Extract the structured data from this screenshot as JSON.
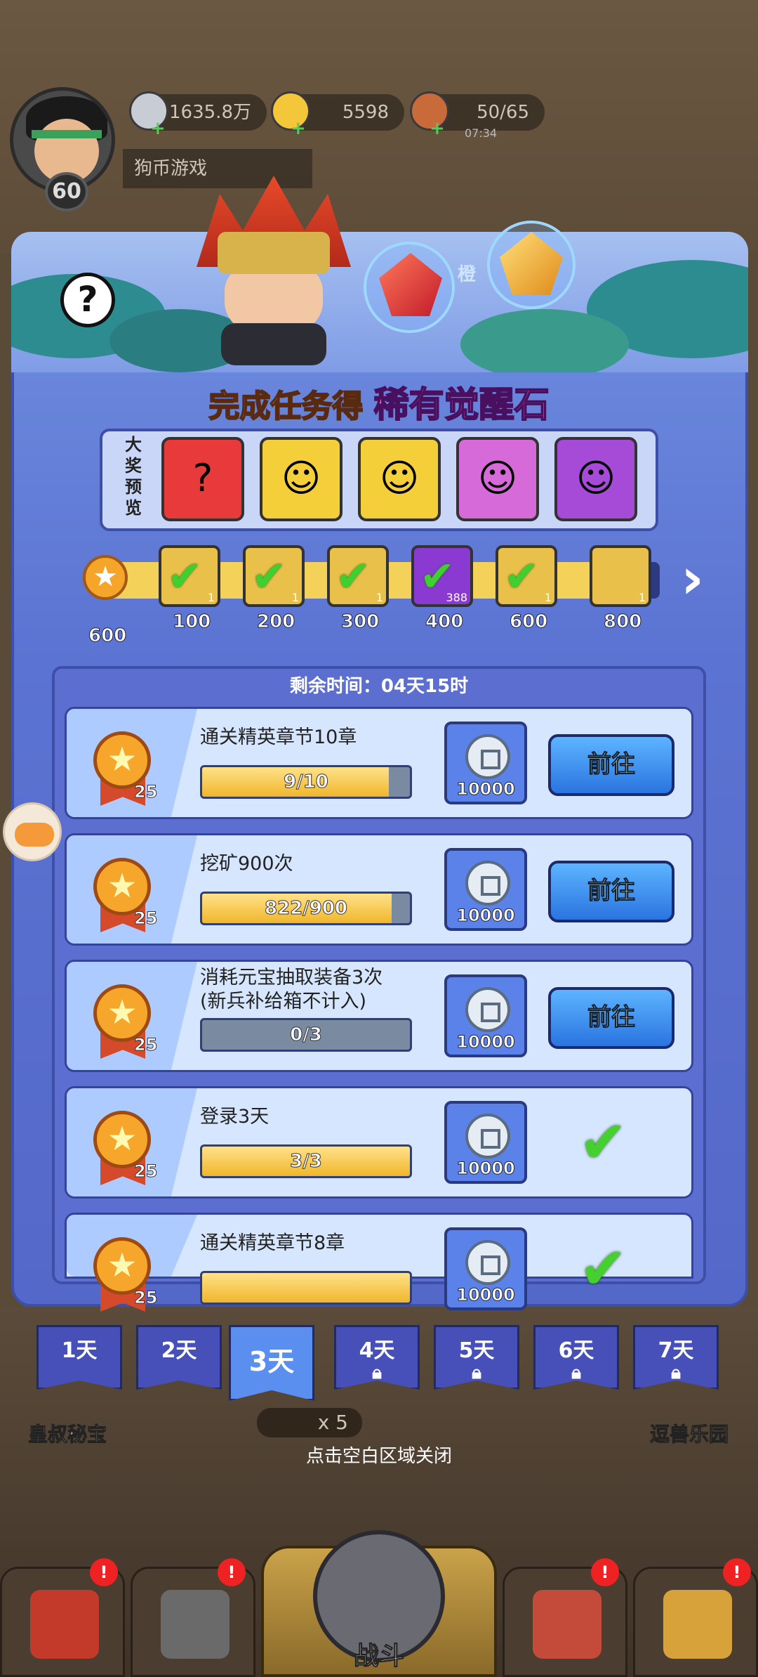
{
  "header": {
    "coins": "1635.8万",
    "ingots": "5598",
    "stamina": "50/65",
    "stamina_timer": "07:34",
    "player_name": "狗币游戏",
    "level": "60"
  },
  "modal": {
    "title_prefix": "完成任务得",
    "title_highlight": "稀有觉醒石",
    "help": "?",
    "gem_label": "橙",
    "preview_label": "大奖预览",
    "preview_items": [
      {
        "name": "random-piece",
        "color": "#e83a3a",
        "glyph": "?"
      },
      {
        "name": "hero-1",
        "color": "#f4cf3a",
        "glyph": "☺"
      },
      {
        "name": "hero-2",
        "color": "#f4cf3a",
        "glyph": "☺"
      },
      {
        "name": "hero-3",
        "color": "#d66ad8",
        "glyph": "☺"
      },
      {
        "name": "hero-4",
        "color": "#a64ad8",
        "glyph": "☺"
      }
    ],
    "current_points": "600",
    "milestones": [
      {
        "label": "100",
        "count": "1",
        "claimed": true,
        "color": "#e9c04a"
      },
      {
        "label": "200",
        "count": "1",
        "claimed": true,
        "color": "#e9c04a"
      },
      {
        "label": "300",
        "count": "1",
        "claimed": true,
        "color": "#e9c04a"
      },
      {
        "label": "400",
        "count": "388",
        "claimed": true,
        "color": "#8a3ad0"
      },
      {
        "label": "600",
        "count": "1",
        "claimed": true,
        "color": "#e9c04a"
      },
      {
        "label": "800",
        "count": "1",
        "claimed": false,
        "color": "#e9c04a"
      }
    ],
    "remaining_time": "剩余时间：04天15时",
    "tasks": [
      {
        "name": "通关精英章节10章",
        "progress": "9/10",
        "ratio": 0.9,
        "points": "25",
        "reward": "10000",
        "action": "前往",
        "done": false
      },
      {
        "name": "挖矿900次",
        "progress": "822/900",
        "ratio": 0.913,
        "points": "25",
        "reward": "10000",
        "action": "前往",
        "done": false
      },
      {
        "name": "消耗元宝抽取装备3次\n(新兵补给箱不计入)",
        "progress": "0/3",
        "ratio": 0,
        "points": "25",
        "reward": "10000",
        "action": "前往",
        "done": false
      },
      {
        "name": "登录3天",
        "progress": "3/3",
        "ratio": 1,
        "points": "25",
        "reward": "10000",
        "action": "",
        "done": true
      },
      {
        "name": "通关精英章节8章",
        "progress": "",
        "ratio": 1,
        "points": "25",
        "reward": "10000",
        "action": "",
        "done": true
      }
    ]
  },
  "day_tabs": [
    {
      "label": "1天",
      "locked": false,
      "active": false
    },
    {
      "label": "2天",
      "locked": false,
      "active": false
    },
    {
      "label": "3天",
      "locked": false,
      "active": true
    },
    {
      "label": "4天",
      "locked": true,
      "active": false
    },
    {
      "label": "5天",
      "locked": true,
      "active": false
    },
    {
      "label": "6天",
      "locked": true,
      "active": false
    },
    {
      "label": "7天",
      "locked": true,
      "active": false
    }
  ],
  "close_hint": "点击空白区域关闭",
  "bottom": {
    "left_label": "皇叔秘宝",
    "right_label": "逗兽乐园",
    "stamina_cost": "x 5",
    "battle_label": "战斗",
    "badge": "!"
  }
}
